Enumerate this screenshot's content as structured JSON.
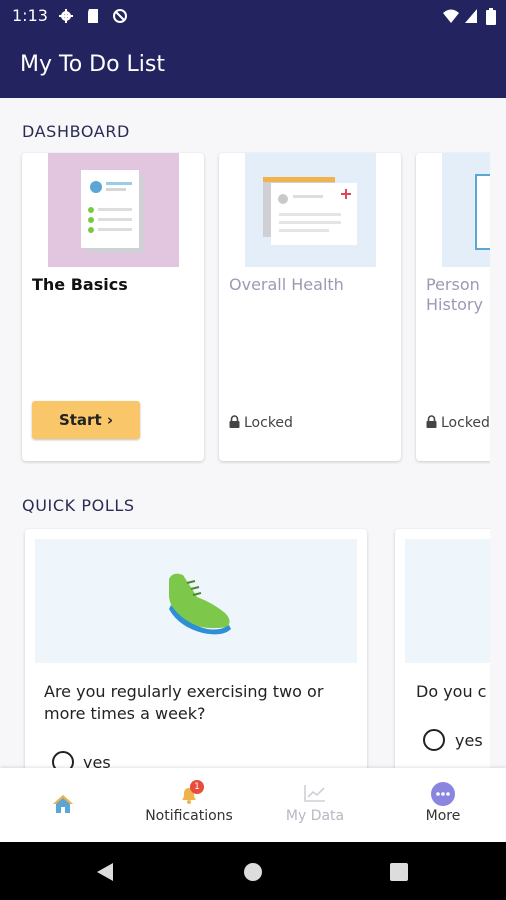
{
  "status_bar": {
    "time": "1:13"
  },
  "app_bar": {
    "title": "My To Do List"
  },
  "dashboard": {
    "section_title": "DASHBOARD",
    "cards": [
      {
        "title": "The Basics",
        "action_label": "Start ›"
      },
      {
        "title": "Overall Health",
        "status": "Locked"
      },
      {
        "title_line1": "Person",
        "title_line2": "History",
        "status": "Locked"
      }
    ]
  },
  "quick_polls": {
    "section_title": "QUICK POLLS",
    "polls": [
      {
        "question": "Are you regularly exercising two or more times a week?",
        "option": "yes"
      },
      {
        "question": "Do you c",
        "option": "yes"
      }
    ]
  },
  "bottom_nav": {
    "items": [
      {
        "label": ""
      },
      {
        "label": "Notifications",
        "badge": "1"
      },
      {
        "label": "My Data"
      },
      {
        "label": "More"
      }
    ]
  },
  "colors": {
    "primary": "#22235f",
    "accent_button": "#f9c76a",
    "locked_text": "#9a9ab5",
    "badge": "#e74c3c",
    "more_icon": "#8a86e0"
  }
}
